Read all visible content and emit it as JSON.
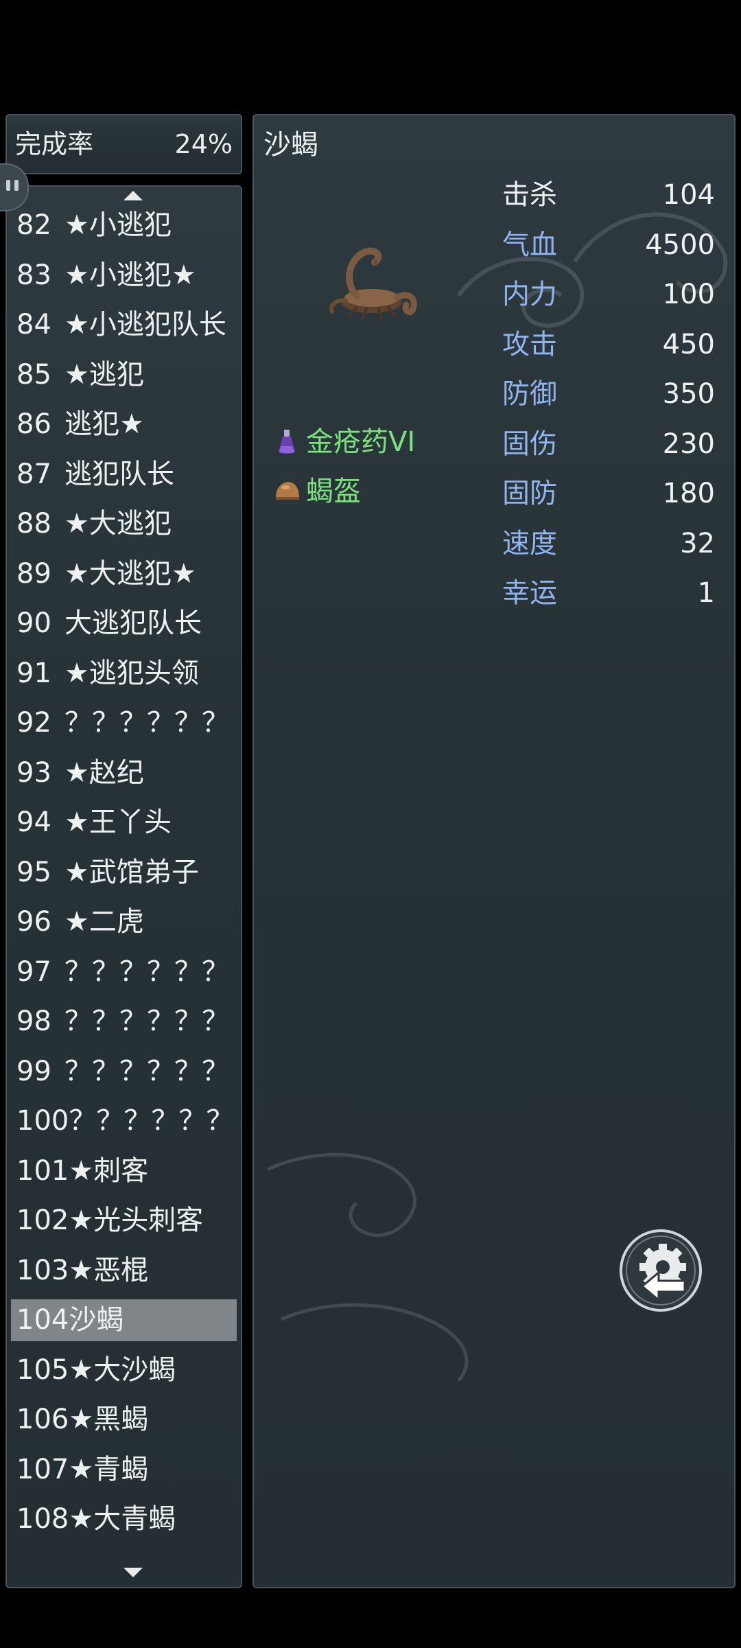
{
  "completion": {
    "label": "完成率",
    "value": "24%"
  },
  "list": [
    {
      "num": "82",
      "name": "★小逃犯"
    },
    {
      "num": "83",
      "name": "★小逃犯★"
    },
    {
      "num": "84",
      "name": "★小逃犯队长"
    },
    {
      "num": "85",
      "name": "★逃犯"
    },
    {
      "num": "86",
      "name": "逃犯★"
    },
    {
      "num": "87",
      "name": "逃犯队长"
    },
    {
      "num": "88",
      "name": "★大逃犯"
    },
    {
      "num": "89",
      "name": "★大逃犯★"
    },
    {
      "num": "90",
      "name": "大逃犯队长"
    },
    {
      "num": "91",
      "name": "★逃犯头领"
    },
    {
      "num": "92",
      "name": "？？？？？？"
    },
    {
      "num": "93",
      "name": "★赵纪"
    },
    {
      "num": "94",
      "name": "★王丫头"
    },
    {
      "num": "95",
      "name": "★武馆弟子"
    },
    {
      "num": "96",
      "name": "★二虎"
    },
    {
      "num": "97",
      "name": "？？？？？？"
    },
    {
      "num": "98",
      "name": "？？？？？？"
    },
    {
      "num": "99",
      "name": "？？？？？？"
    },
    {
      "num": "100",
      "name": "？？？？？？"
    },
    {
      "num": "101",
      "name": "★刺客"
    },
    {
      "num": "102",
      "name": "★光头刺客"
    },
    {
      "num": "103",
      "name": "★恶棍"
    },
    {
      "num": "104",
      "name": "沙蝎",
      "selected": true
    },
    {
      "num": "105",
      "name": "★大沙蝎"
    },
    {
      "num": "106",
      "name": "★黑蝎"
    },
    {
      "num": "107",
      "name": "★青蝎"
    },
    {
      "num": "108",
      "name": "★大青蝎"
    }
  ],
  "detail": {
    "name": "沙蝎",
    "drops": [
      {
        "name": "金疮药VI",
        "icon": "potion-icon"
      },
      {
        "name": "蝎盔",
        "icon": "helmet-icon"
      }
    ],
    "stats": [
      {
        "key": "击杀",
        "value": "104",
        "color": "#eef1f1"
      },
      {
        "key": "气血",
        "value": "4500",
        "color": "#8fb4f0"
      },
      {
        "key": "内力",
        "value": "100",
        "color": "#8fb4f0"
      },
      {
        "key": "攻击",
        "value": "450",
        "color": "#8fb4f0"
      },
      {
        "key": "防御",
        "value": "350",
        "color": "#8fb4f0"
      },
      {
        "key": "固伤",
        "value": "230",
        "color": "#8fb4f0"
      },
      {
        "key": "固防",
        "value": "180",
        "color": "#8fb4f0"
      },
      {
        "key": "速度",
        "value": "32",
        "color": "#8fb4f0"
      },
      {
        "key": "幸运",
        "value": "1",
        "color": "#8fb4f0"
      }
    ]
  },
  "colors": {
    "drop_text": "#7ce37c",
    "stat_key": "#8fb4f0",
    "selected_row": "#7f8588"
  },
  "icons": [
    "scroll-up-icon",
    "scroll-down-icon",
    "scorpion-icon",
    "potion-icon",
    "helmet-icon",
    "gear-back-icon"
  ]
}
